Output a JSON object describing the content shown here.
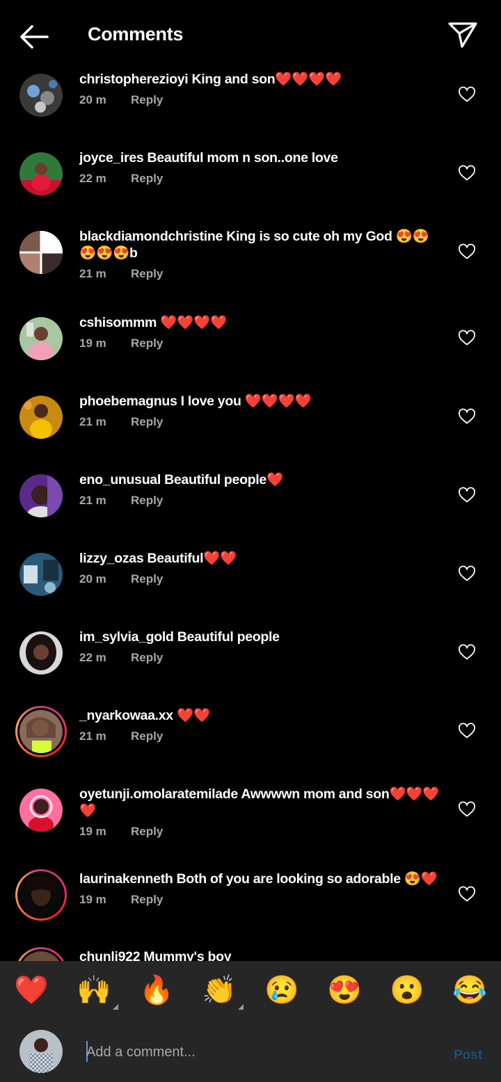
{
  "header": {
    "title": "Comments"
  },
  "comments": [
    {
      "user": "christopherezioyi",
      "text": "King and son❤️❤️❤️❤️",
      "time": "20 m",
      "reply": "Reply"
    },
    {
      "user": "joyce_ires",
      "text": "Beautiful mom n son..one love",
      "time": "22 m",
      "reply": "Reply"
    },
    {
      "user": "blackdiamondchristine",
      "text": "King is so cute oh my God 😍😍😍😍😍b",
      "time": "21 m",
      "reply": "Reply"
    },
    {
      "user": "cshisommm",
      "text": "❤️❤️❤️❤️",
      "time": "19 m",
      "reply": "Reply"
    },
    {
      "user": "phoebemagnus",
      "text": "I love you ❤️❤️❤️❤️",
      "time": "21 m",
      "reply": "Reply"
    },
    {
      "user": "eno_unusual",
      "text": "Beautiful people❤️",
      "time": "21 m",
      "reply": "Reply"
    },
    {
      "user": "lizzy_ozas",
      "text": "Beautiful❤️❤️",
      "time": "20 m",
      "reply": "Reply"
    },
    {
      "user": "im_sylvia_gold",
      "text": "Beautiful people",
      "time": "22 m",
      "reply": "Reply"
    },
    {
      "user": "_nyarkowaa.xx",
      "text": "❤️❤️",
      "time": "21 m",
      "reply": "Reply"
    },
    {
      "user": "oyetunji.omolaratemilade",
      "text": "Awwwwn mom and son❤️❤️❤️❤️",
      "time": "19 m",
      "reply": "Reply"
    },
    {
      "user": "laurinakenneth",
      "text": "Both of you are looking so adorable 😍❤️",
      "time": "19 m",
      "reply": "Reply"
    },
    {
      "user": "chunli922",
      "text": "Mummy's boy",
      "time": "",
      "reply": ""
    }
  ],
  "emoji_bar": [
    "❤️",
    "🙌",
    "🔥",
    "👏",
    "😢",
    "😍",
    "😮",
    "😂"
  ],
  "composer": {
    "placeholder": "Add a comment...",
    "post_label": "Post"
  },
  "colors": {
    "background": "#000000",
    "panel": "#262626",
    "muted": "#a8a8a8",
    "post": "#1f4e78",
    "heart": "#ed4956"
  }
}
